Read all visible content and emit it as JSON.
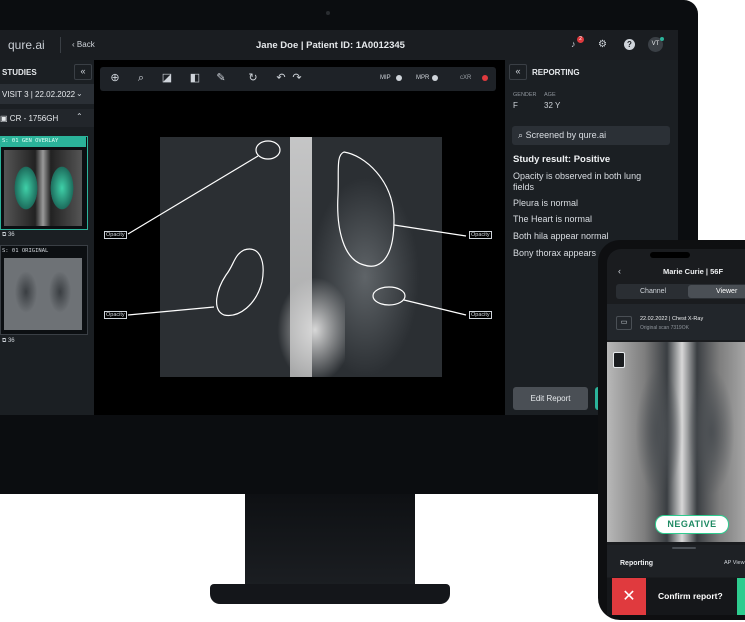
{
  "app": {
    "logo": "qure.ai",
    "back_label": "Back",
    "title": "Jane Doe | Patient ID: 1A0012345",
    "notification_count": "2",
    "avatar_initials": "VT"
  },
  "studies": {
    "header": "STUDIES",
    "visit": "VISIT 3 | 22.02.2022",
    "series": "CR - 1756GH",
    "thumb1_label": "S: 01  GEN OVERLAY",
    "thumb1_count": "36",
    "thumb2_label": "S: 01  ORIGINAL",
    "thumb2_count": "36"
  },
  "toolbar": {
    "mip": "MIP",
    "mpr": "MPR",
    "cxr": "cXR"
  },
  "annotations": {
    "opacity": "Opacity"
  },
  "reporting": {
    "header": "REPORTING",
    "gender_label": "GENDER",
    "gender_value": "F",
    "age_label": "AGE",
    "age_value": "32 Y",
    "screened_label": "Screened by qure.ai",
    "result_title": "Study result: Positive",
    "findings": [
      "Opacity is observed in both lung",
      "fields",
      "Pleura is normal",
      "The Heart is normal",
      "Both hila appear normal",
      "Bony thorax appears"
    ],
    "edit_button": "Edit Report"
  },
  "phone": {
    "patient": "Marie Curie | 56F",
    "tab_channel": "Channel",
    "tab_viewer": "Viewer",
    "study_date": "22.02.2022 | Chest X-Ray",
    "study_sub": "Original scan 7319OK",
    "badge": "NEGATIVE",
    "reporting_label": "Reporting",
    "view_label": "AP View",
    "confirm_label": "Confirm report?"
  },
  "colors": {
    "accent": "#2bb39a",
    "alert": "#e03a3e",
    "badge_green": "#2ecc8f"
  }
}
